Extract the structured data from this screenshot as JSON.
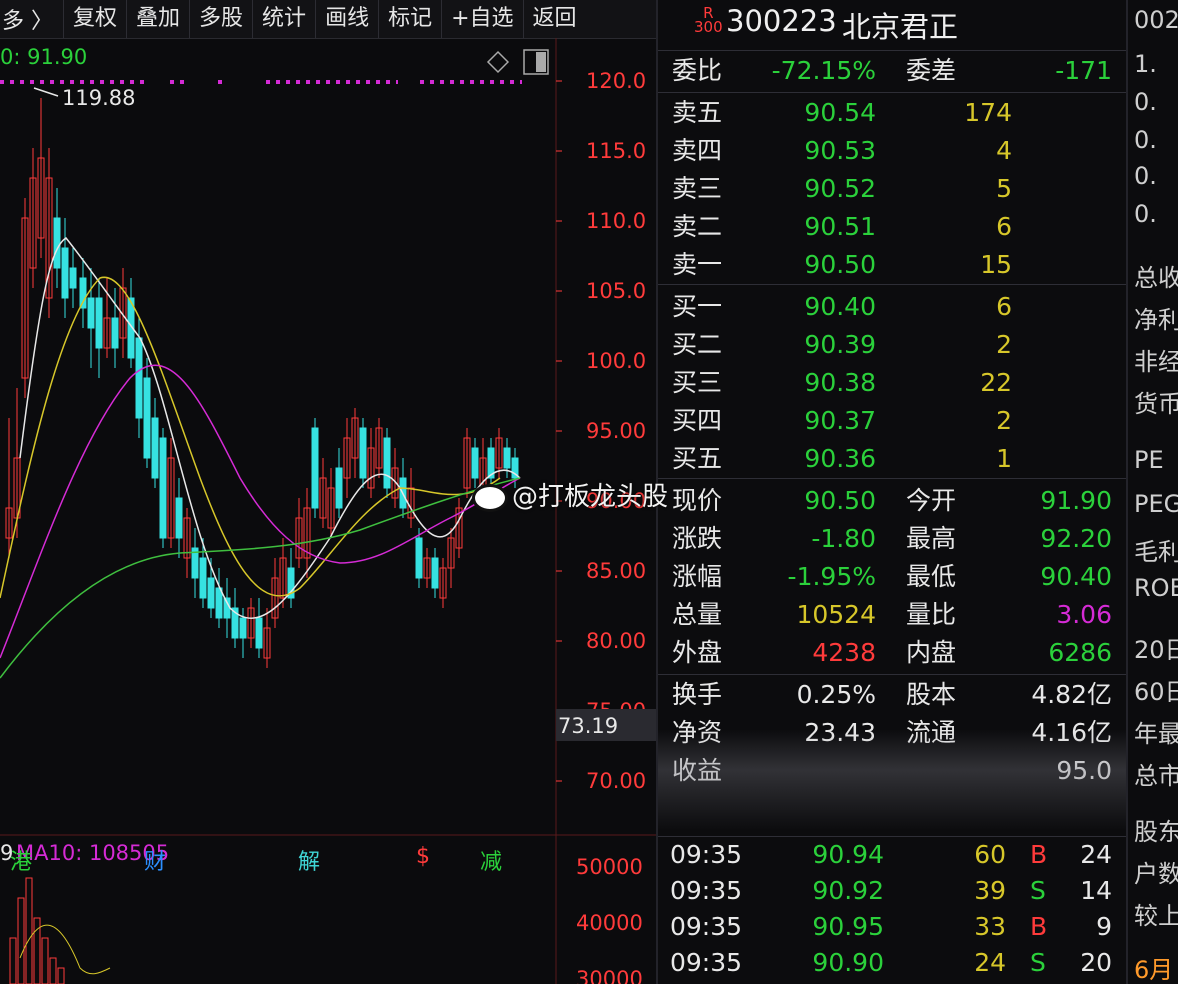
{
  "toolbar": {
    "nav": "多 〉",
    "buttons": [
      "复权",
      "叠加",
      "多股",
      "统计",
      "画线",
      "标记",
      "+自选",
      "返回"
    ]
  },
  "kline": {
    "ma_label": "0: 91.90",
    "high_marker": "119.88",
    "price_axis": [
      "120.0",
      "115.0",
      "110.0",
      "105.0",
      "100.0",
      "95.00",
      "90.00",
      "85.00",
      "80.00",
      "75.00",
      "70.00"
    ],
    "current_price_label": "73.19",
    "event_tags": [
      {
        "label": "港",
        "color": "#2bd13b"
      },
      {
        "label": "财",
        "color": "#2b8fff"
      },
      {
        "label": "解",
        "color": "#3fd5d5"
      },
      {
        "label": "$",
        "color": "#ff3b3b"
      },
      {
        "label": "减",
        "color": "#2bd13b"
      }
    ]
  },
  "volume": {
    "label_left": "9",
    "label_ma10": "MA10: 108505",
    "axis": [
      "50000",
      "40000",
      "30000"
    ]
  },
  "quote": {
    "badge_top": "R",
    "badge_bottom": "300",
    "code": "300223",
    "name": "北京君正",
    "ratio_label": "委比",
    "ratio_value": "-72.15%",
    "diff_label": "委差",
    "diff_value": "-171",
    "asks": [
      {
        "label": "卖五",
        "price": "90.54",
        "vol": "174"
      },
      {
        "label": "卖四",
        "price": "90.53",
        "vol": "4"
      },
      {
        "label": "卖三",
        "price": "90.52",
        "vol": "5"
      },
      {
        "label": "卖二",
        "price": "90.51",
        "vol": "6"
      },
      {
        "label": "卖一",
        "price": "90.50",
        "vol": "15"
      }
    ],
    "bids": [
      {
        "label": "买一",
        "price": "90.40",
        "vol": "6"
      },
      {
        "label": "买二",
        "price": "90.39",
        "vol": "2"
      },
      {
        "label": "买三",
        "price": "90.38",
        "vol": "22"
      },
      {
        "label": "买四",
        "price": "90.37",
        "vol": "2"
      },
      {
        "label": "买五",
        "price": "90.36",
        "vol": "1"
      }
    ],
    "stats": [
      {
        "l1": "现价",
        "v1": "90.50",
        "c1": "green",
        "l2": "今开",
        "v2": "91.90",
        "c2": "green"
      },
      {
        "l1": "涨跌",
        "v1": "-1.80",
        "c1": "green",
        "l2": "最高",
        "v2": "92.20",
        "c2": "green"
      },
      {
        "l1": "涨幅",
        "v1": "-1.95%",
        "c1": "green",
        "l2": "最低",
        "v2": "90.40",
        "c2": "green"
      },
      {
        "l1": "总量",
        "v1": "10524",
        "c1": "yellow",
        "l2": "量比",
        "v2": "3.06",
        "c2": "magenta"
      },
      {
        "l1": "外盘",
        "v1": "4238",
        "c1": "red",
        "l2": "内盘",
        "v2": "6286",
        "c2": "green"
      }
    ],
    "stats2": [
      {
        "l1": "换手",
        "v1": "0.25%",
        "l2": "股本",
        "v2": "4.82亿"
      },
      {
        "l1": "净资",
        "v1": "23.43",
        "l2": "流通",
        "v2": "4.16亿"
      },
      {
        "l1": "收益",
        "v1": "",
        "l2": "",
        "v2": "95.0"
      }
    ],
    "ticks": [
      {
        "time": "09:35",
        "price": "90.94",
        "vol": "60",
        "bs": "B",
        "num": "24"
      },
      {
        "time": "09:35",
        "price": "90.92",
        "vol": "39",
        "bs": "S",
        "num": "14"
      },
      {
        "time": "09:35",
        "price": "90.95",
        "vol": "33",
        "bs": "B",
        "num": "9"
      },
      {
        "time": "09:35",
        "price": "90.90",
        "vol": "24",
        "bs": "S",
        "num": "20"
      }
    ]
  },
  "far_panel": {
    "items": [
      "002",
      "1.",
      "0.",
      "0.",
      "0.",
      "0.",
      "总收",
      "净利",
      "非经",
      "货币",
      "PE",
      "PEG",
      "毛利",
      "ROE",
      "20日",
      "60日",
      "年最",
      "总市",
      "股东",
      "户数",
      "较上",
      "6月"
    ]
  },
  "watermark": "@打板龙头股"
}
